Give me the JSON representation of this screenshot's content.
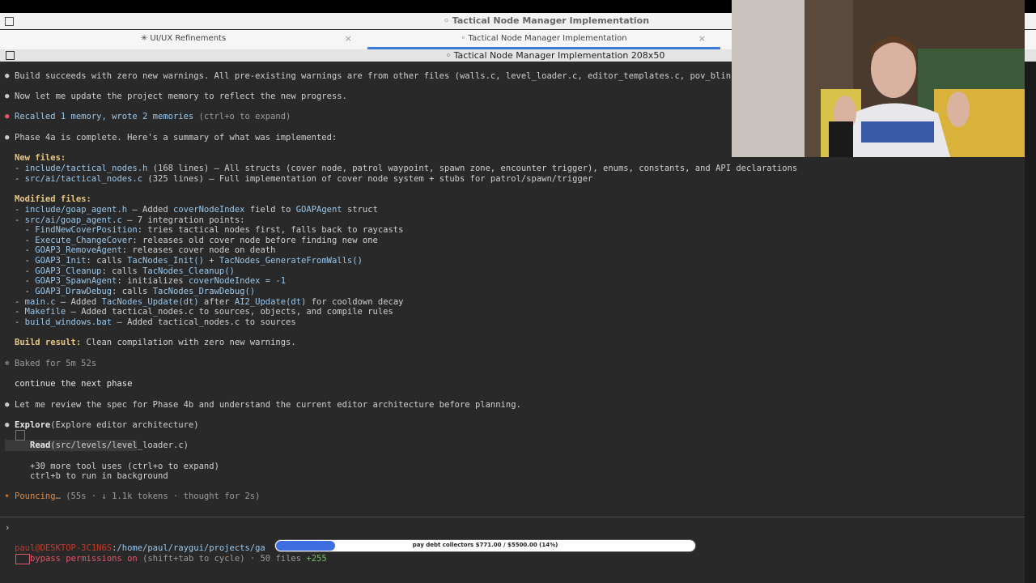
{
  "window": {
    "title": "◦ Tactical Node Manager Implementation"
  },
  "tabs": [
    {
      "label": "✳ UI/UX Refinements",
      "close": "×"
    },
    {
      "label": "◦ Tactical Node Manager Implementation",
      "close": "×"
    }
  ],
  "pane_title": "◦ Tactical Node Manager Implementation 208x50",
  "bullet": "●",
  "lines": {
    "l1": "Build succeeds with zero new warnings. All pre-existing warnings are from other files (walls.c, level_loader.c, editor_templates.c, pov_blin",
    "l2": "Now let me update the project memory to reflect the new progress.",
    "l3a": "Recalled 1 memory, wrote 2 memories",
    "l3b": " (ctrl+o to expand)",
    "l4": "Phase 4a is complete. Here's a summary of what was implemented:",
    "h_new": "New files:",
    "n1a": "- ",
    "n1b": "include/tactical_nodes.h",
    "n1c": " (168 lines) — All structs (cover node, patrol waypoint, spawn zone, encounter trigger), enums, constants, and API declarations",
    "n2a": "- ",
    "n2b": "src/ai/tactical_nodes.c",
    "n2c": " (325 lines) — Full implementation of cover node system + stubs for patrol/spawn/trigger",
    "h_mod": "Modified files:",
    "m1a": "- ",
    "m1b": "include/goap_agent.h",
    "m1c": " — Added ",
    "m1d": "coverNodeIndex",
    "m1e": " field to ",
    "m1f": "GOAPAgent",
    "m1g": " struct",
    "m2a": "- ",
    "m2b": "src/ai/goap_agent.c",
    "m2c": " — 7 integration points:",
    "m3a": "  - ",
    "m3b": "FindNewCoverPosition",
    "m3c": ": tries tactical nodes first, falls back to raycasts",
    "m4a": "  - ",
    "m4b": "Execute_ChangeCover",
    "m4c": ": releases old cover node before finding new one",
    "m5a": "  - ",
    "m5b": "GOAP3_RemoveAgent",
    "m5c": ": releases cover node on death",
    "m6a": "  - ",
    "m6b": "GOAP3_Init",
    "m6c": ": calls ",
    "m6d": "TacNodes_Init()",
    "m6e": " + ",
    "m6f": "TacNodes_GenerateFromWalls()",
    "m7a": "  - ",
    "m7b": "GOAP3_Cleanup",
    "m7c": ": calls ",
    "m7d": "TacNodes_Cleanup()",
    "m8a": "  - ",
    "m8b": "GOAP3_SpawnAgent",
    "m8c": ": initializes ",
    "m8d": "coverNodeIndex = -1",
    "m9a": "  - ",
    "m9b": "GOAP3_DrawDebug",
    "m9c": ": calls ",
    "m9d": "TacNodes_DrawDebug()",
    "m10a": "- ",
    "m10b": "main.c",
    "m10c": " — Added ",
    "m10d": "TacNodes_Update(dt)",
    "m10e": " after ",
    "m10f": "AI2_Update(dt)",
    "m10g": " for cooldown decay",
    "m11a": "- ",
    "m11b": "Makefile",
    "m11c": " — Added tactical_nodes.c to sources, objects, and compile rules",
    "m12a": "- ",
    "m12b": "build_windows.bat",
    "m12c": " — Added tactical_nodes.c to sources",
    "br_a": "Build result:",
    "br_b": " Clean compilation with zero new warnings.",
    "baked": "Baked for 5m 52s",
    "prompt": "continue the next phase",
    "review": "Let me review the spec for Phase 4b and understand the current editor architecture before planning.",
    "ex_a": "Explore",
    "ex_b": "(Explore editor architecture)",
    "read_a": "Read",
    "read_b": "(src/levels/level_loader.c)",
    "more": "+30 more tool uses (ctrl+o to expand)",
    "bg": "ctrl+b to run in background",
    "pounce_a": "Pouncing…",
    "pounce_b": " (55s · ↓ 1.1k tokens · thought for 2s)"
  },
  "input_prompt": "›",
  "status": {
    "user": "paul@DESKTOP-3C1N6S",
    "path": ":/home/paul/raygui/projects/ga",
    "perm": "bypass permissions on",
    "perm_rest": " (shift+tab to cycle) · 50 files ",
    "added": "+255",
    "removed": "-???"
  },
  "progress": {
    "label": "pay debt collectors $771.00 / $5500.00 (14%)",
    "value": 0.14
  },
  "colors": {
    "accent": "#3a7bd5",
    "link": "#9bc7ea",
    "heading": "#e6c77f",
    "alert": "#e0566b",
    "spinner": "#e08a45"
  }
}
